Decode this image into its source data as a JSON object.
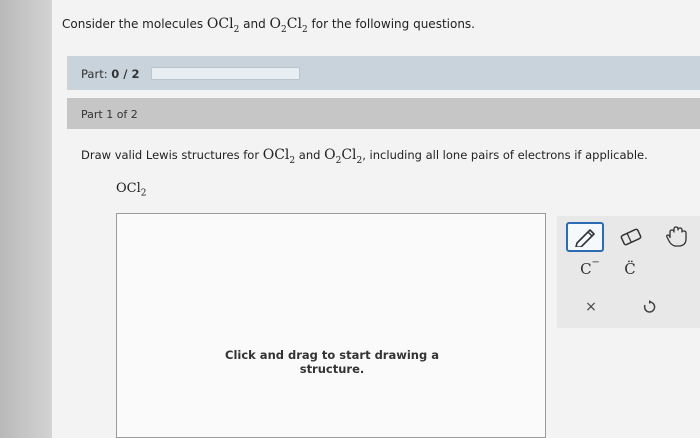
{
  "question": {
    "lead": "Consider the molecules ",
    "mol1": "OCl",
    "mol1_sub": "2",
    "and": " and ",
    "mol2_a": "O",
    "mol2_a_sub": "2",
    "mol2_b": "Cl",
    "mol2_b_sub": "2",
    "tail": " for the following questions."
  },
  "part_bar": {
    "label_prefix": "Part: ",
    "label_value": "0 / 2",
    "progress": 0
  },
  "part_header": {
    "title": "Part 1 of 2"
  },
  "instructions": {
    "lead": "Draw valid Lewis structures for ",
    "mol1": "OCl",
    "mol1_sub": "2",
    "and": " and ",
    "mol2_a": "O",
    "mol2_a_sub": "2",
    "mol2_b": "Cl",
    "mol2_b_sub": "2",
    "tail": ", including all lone pairs of electrons if applicable."
  },
  "molecule_label": {
    "text": "OCl",
    "sub": "2"
  },
  "canvas": {
    "hint_line1": "Click and drag to start drawing a",
    "hint_line2": "structure."
  },
  "toolbar": {
    "tools": [
      {
        "name": "pencil-icon"
      },
      {
        "name": "eraser-icon"
      },
      {
        "name": "hand-icon"
      },
      {
        "name": "carbanion",
        "glyph": "C",
        "sup": "−"
      },
      {
        "name": "lone-pair",
        "glyph": "C̈"
      },
      {
        "name": "close-icon",
        "glyph": "×"
      },
      {
        "name": "undo-icon"
      }
    ],
    "accent": "#2d6cb3"
  }
}
